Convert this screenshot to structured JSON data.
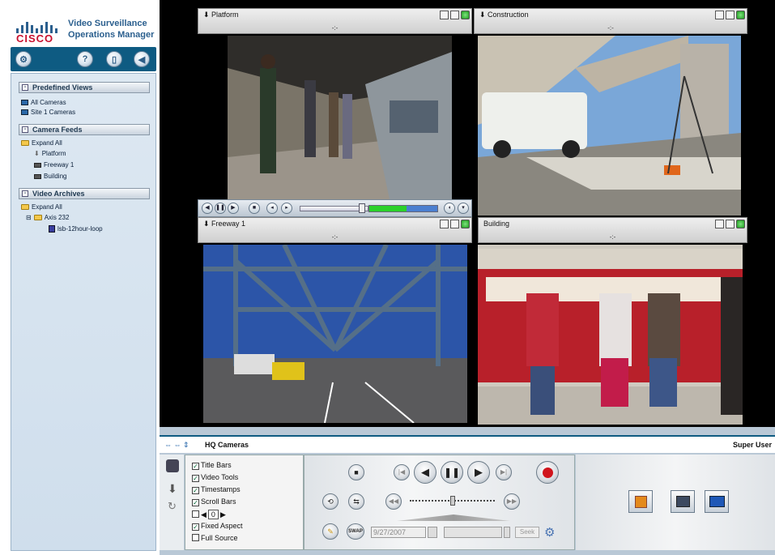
{
  "app": {
    "brand": "CISCO",
    "title_line1": "Video Surveillance",
    "title_line2": "Operations Manager"
  },
  "sidebar": {
    "sections": [
      {
        "label": "Predefined Views",
        "items": [
          "All Cameras",
          "Site 1 Cameras"
        ]
      },
      {
        "label": "Camera Feeds",
        "items": [
          "Expand All",
          "Platform",
          "Freeway 1",
          "Building"
        ]
      },
      {
        "label": "Video Archives",
        "items": [
          "Expand All",
          "Axis 232",
          "lsb-12hour-loop"
        ]
      }
    ]
  },
  "cameras": [
    {
      "name": "Platform",
      "timestamp": "-:-"
    },
    {
      "name": "Construction",
      "timestamp": "-:-"
    },
    {
      "name": "Freeway 1",
      "timestamp": "-:-"
    },
    {
      "name": "Building",
      "timestamp": "-:-"
    }
  ],
  "bottom": {
    "group": "HQ Cameras",
    "user": "Super User",
    "options": [
      {
        "label": "Title Bars",
        "checked": true
      },
      {
        "label": "Video Tools",
        "checked": true
      },
      {
        "label": "Timestamps",
        "checked": true
      },
      {
        "label": "Scroll Bars",
        "checked": true
      },
      {
        "label": "0",
        "checked": false
      },
      {
        "label": "Fixed Aspect",
        "checked": true
      },
      {
        "label": "Full Source",
        "checked": false
      }
    ],
    "date": "9/27/2007",
    "seek_label": "Seek",
    "swap_label": "SWAP"
  },
  "colors": {
    "header": "#0e5b82",
    "panel": "#dde8f2",
    "accent_red": "#c8102e"
  }
}
